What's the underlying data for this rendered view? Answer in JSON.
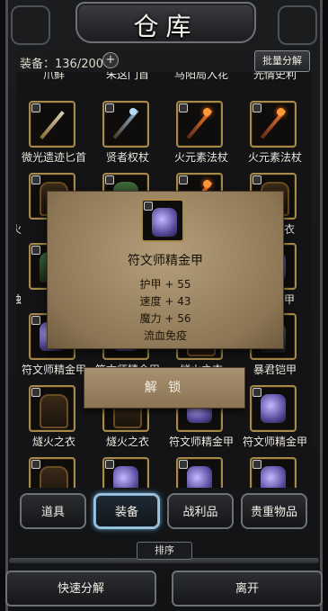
{
  "header": {
    "title": "仓库"
  },
  "topbar": {
    "capacity_label": "装备：136/200",
    "plus_symbol": "+",
    "bulk_label": "批量分解"
  },
  "grid": {
    "partial_row": [
      "爪鲜",
      "朱这门首",
      "马阳局入花",
      "光情史利"
    ],
    "row1": [
      "微光遗迹匕首",
      "贤者权杖",
      "火元素法杖",
      "火元素法杖"
    ],
    "row2_left": "燧火",
    "row2_right": "之衣",
    "row3_left": "腐蚀",
    "row3_right": "鳞甲",
    "row4": [
      "符文师精金甲",
      "符文师精金甲",
      "燧火之衣",
      "暴君铠甲"
    ],
    "row5": [
      "燧火之衣",
      "燧火之衣",
      "符文师精金甲",
      "符文师精金甲"
    ]
  },
  "popup": {
    "item_name": "符文师精金甲",
    "stats": [
      "护甲 + 55",
      "速度 + 43",
      "魔力 + 56",
      "流血免疫"
    ],
    "unlock_label": "解 锁"
  },
  "tabs": [
    "道具",
    "装备",
    "战利品",
    "贵重物品"
  ],
  "active_tab": "装备",
  "sort_label": "排序",
  "bottom": {
    "quick_decompose": "快速分解",
    "leave": "离开"
  }
}
